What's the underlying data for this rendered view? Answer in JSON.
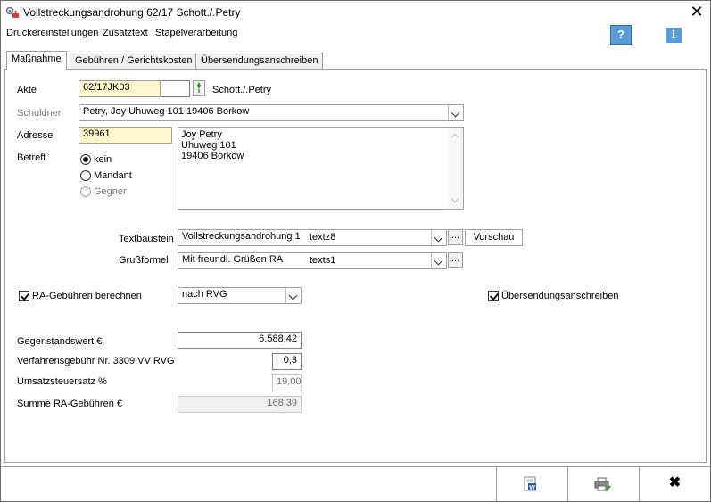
{
  "window": {
    "title": "Vollstreckungsandrohung  62/17 Schott./.Petry",
    "close_symbol": "✕"
  },
  "menu": {
    "items": [
      "Druckereinstellungen",
      "Zusatztext",
      "Stapelverarbeitung"
    ],
    "help_symbol": "?",
    "info_symbol": "i"
  },
  "tabs": [
    "Maßnahme",
    "Gebühren / Gerichtskosten",
    "Übersendungsanschreiben"
  ],
  "form": {
    "akte_label": "Akte",
    "akte_value": "62/17JK03",
    "akte_name": "Schott./.Petry",
    "schuldner_label": "Schuldner",
    "schuldner_value": "Petry, Joy  Uhuweg 101 19406 Borkow",
    "adresse_label": "Adresse",
    "adresse_value": "39961",
    "address_lines": [
      "Joy Petry",
      "Uhuweg 101",
      "19406 Borkow"
    ],
    "betreff_label": "Betreff",
    "betreff_options": [
      "kein",
      "Mandant",
      "Gegner"
    ],
    "betreff_selected": "kein",
    "textbaustein_label": "Textbaustein",
    "textbaustein_value": "Vollstreckungsandrohung 1",
    "textbaustein_code": "textz8",
    "vorschau_label": "Vorschau",
    "grussformel_label": "Grußformel",
    "grussformel_value": "Mit freundl. Grüßen RA",
    "grussformel_code": "texts1",
    "ellipsis": "...",
    "ra_gebuehren_label": "RA-Gebühren berechnen",
    "ra_gebuehren_checked": true,
    "rvg_value": "nach RVG",
    "uebersendung_label": "Übersendungsanschreiben",
    "uebersendung_checked": true,
    "gegenstandswert_label": "Gegenstandswert €",
    "gegenstandswert_value": "6.588,42",
    "verfahrensgebuehr_label": "Verfahrensgebühr Nr. 3309 VV RVG",
    "verfahrensgebuehr_value": "0,3",
    "ust_label": "Umsatzsteuersatz %",
    "ust_value": "19,00",
    "summe_label": "Summe RA-Gebühren €",
    "summe_value": "168,39"
  },
  "bottom": {
    "close_symbol": "✖"
  },
  "icons": {
    "app": "gear-stamp-icon",
    "word": "word-document-icon",
    "print": "printer-check-icon",
    "close": "close-icon"
  },
  "colors": {
    "help_blue": "#5b9bd5",
    "input_yellow": "#fff7cc"
  }
}
